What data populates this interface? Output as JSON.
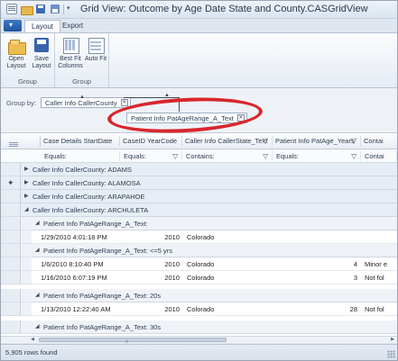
{
  "window": {
    "title": "Grid View: Outcome by Age Date State and County.CASGridView"
  },
  "ribbon": {
    "tabs": [
      {
        "label": "Layout"
      },
      {
        "label": "Export"
      }
    ],
    "groups": [
      {
        "label": "Group",
        "buttons": [
          {
            "label": "Open Layout"
          },
          {
            "label": "Save Layout"
          }
        ]
      },
      {
        "label": "Group",
        "buttons": [
          {
            "label": "Best Fit Columns"
          },
          {
            "label": "Auto Fit"
          }
        ]
      }
    ]
  },
  "group_panel": {
    "label": "Group by:",
    "chips": [
      {
        "label": "Caller Info CallerCounty"
      },
      {
        "label": "Patient Info PatAgeRange_A_Text"
      }
    ]
  },
  "grid": {
    "columns": [
      {
        "label": "Case Details StartDate"
      },
      {
        "label": "CaseID YearCode"
      },
      {
        "label": "Caller Info CallerState_Text"
      },
      {
        "label": "Patient Info PatAge_Years"
      },
      {
        "label": "Contai"
      }
    ],
    "filters": [
      "Equals:",
      "Equals:",
      "Contains:",
      "Equals:",
      "Contai"
    ],
    "groups_l1": [
      {
        "label": "Caller Info CallerCounty: ADAMS"
      },
      {
        "label": "Caller Info CallerCounty: ALAMOSA"
      },
      {
        "label": "Caller Info CallerCounty: ARAPAHOE"
      },
      {
        "label": "Caller Info CallerCounty: ARCHULETA"
      }
    ],
    "groups_l2": [
      {
        "label": "Patient Info PatAgeRange_A_Text:"
      },
      {
        "label": "Patient Info PatAgeRange_A_Text: <=5 yrs"
      },
      {
        "label": "Patient Info PatAgeRange_A_Text: 20s"
      },
      {
        "label": "Patient Info PatAgeRange_A_Text: 30s"
      }
    ],
    "rows": [
      {
        "date": "1/29/2010 4:01:18 PM",
        "year": "2010",
        "state": "Colorado",
        "years": "",
        "outcome": ""
      },
      {
        "date": "1/6/2010 8:10:40 PM",
        "year": "2010",
        "state": "Colorado",
        "years": "4",
        "outcome": "Minor e"
      },
      {
        "date": "1/16/2010 6:07:19 PM",
        "year": "2010",
        "state": "Colorado",
        "years": "3",
        "outcome": "Not fol"
      },
      {
        "date": "1/13/2010 12:22:40 AM",
        "year": "2010",
        "state": "Colorado",
        "years": "28",
        "outcome": "Not fol"
      }
    ]
  },
  "status": {
    "text": "5,905 rows found"
  },
  "colors": {
    "highlight": "#d8262c",
    "accent": "#20559f"
  }
}
